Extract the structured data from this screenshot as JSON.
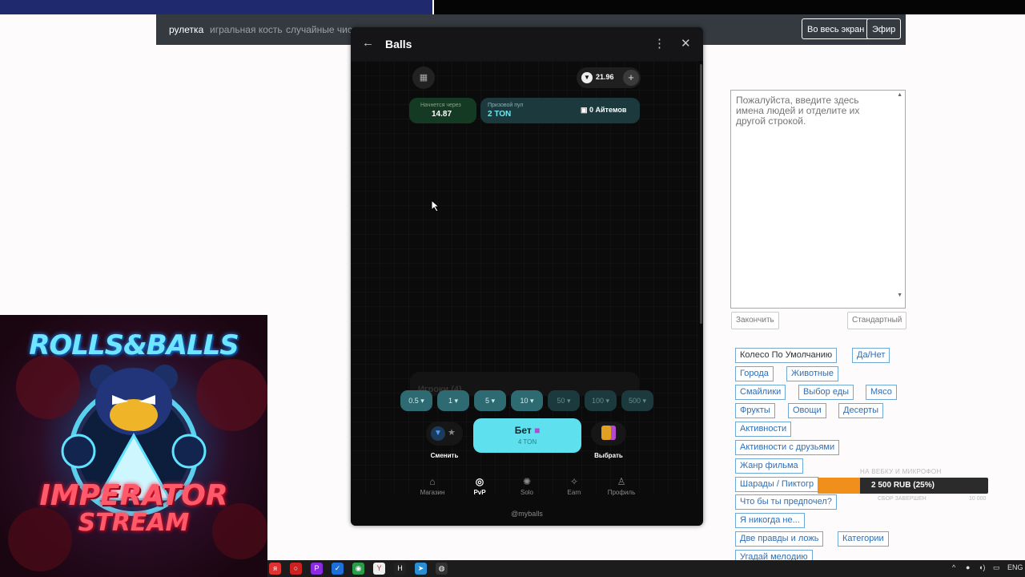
{
  "navbar": {
    "items": [
      "рулетка",
      "игральная кость",
      "случайные числ"
    ],
    "fullscreen_button": "Во весь экран",
    "live_button": "Эфир"
  },
  "modal": {
    "title": "Balls",
    "balance": "21.96",
    "starts_in_label": "Начнется через",
    "starts_in_value": "14.87",
    "prize_pool_label": "Призовой пул",
    "prize_pool_value": "2 TON",
    "items_count": "0 Айтемов",
    "players_label": "Игроки (4)",
    "bet_chips": [
      "0.5",
      "1",
      "5",
      "10",
      "50",
      "100",
      "500"
    ],
    "switch_label": "Сменить",
    "bet_button": "Бет",
    "bet_amount": "4 TON",
    "choose_label": "Выбрать",
    "bottom_nav": [
      "Магазин",
      "PvP",
      "Solo",
      "Earn",
      "Профиль"
    ],
    "footer": "@myballs"
  },
  "right_panel": {
    "textarea_placeholder": "Пожалуйста, введите здесь имена людей и отделите их другой строкой.",
    "finish_button": "Закончить",
    "standard_button": "Стандартный",
    "tags": [
      "Колесо По Умолчанию",
      "Да/Нет",
      "Города",
      "Животные",
      "Смайлики",
      "Выбор еды",
      "Мясо",
      "Фрукты",
      "Овощи",
      "Десерты",
      "Активности",
      "Активности с друзьями",
      "Жанр фильма",
      "Шарады / Пиктогр",
      "Что бы ты предпочел?",
      "Я никогда не...",
      "Две правды и ложь",
      "Категории",
      "Угадай мелодию"
    ]
  },
  "stream_art": {
    "title_top": "ROLLS&BALLS",
    "title_mid": "IMPERATOR",
    "title_bottom": "STREAM"
  },
  "donation": {
    "heading": "НА ВЕБКУ И МИКРОФОН",
    "amount": "2 500 RUB (25%)",
    "progress_percent": 25,
    "sub_left": "СБОР ЗАВЕРШЕН",
    "sub_right": "10 000"
  },
  "taskbar": {
    "language": "ENG"
  },
  "colors": {
    "navbar": "#343a40",
    "accent_cyan": "#5ee0ee",
    "donation_fill": "#f0901a",
    "tag_border": "#6ea8d6"
  }
}
